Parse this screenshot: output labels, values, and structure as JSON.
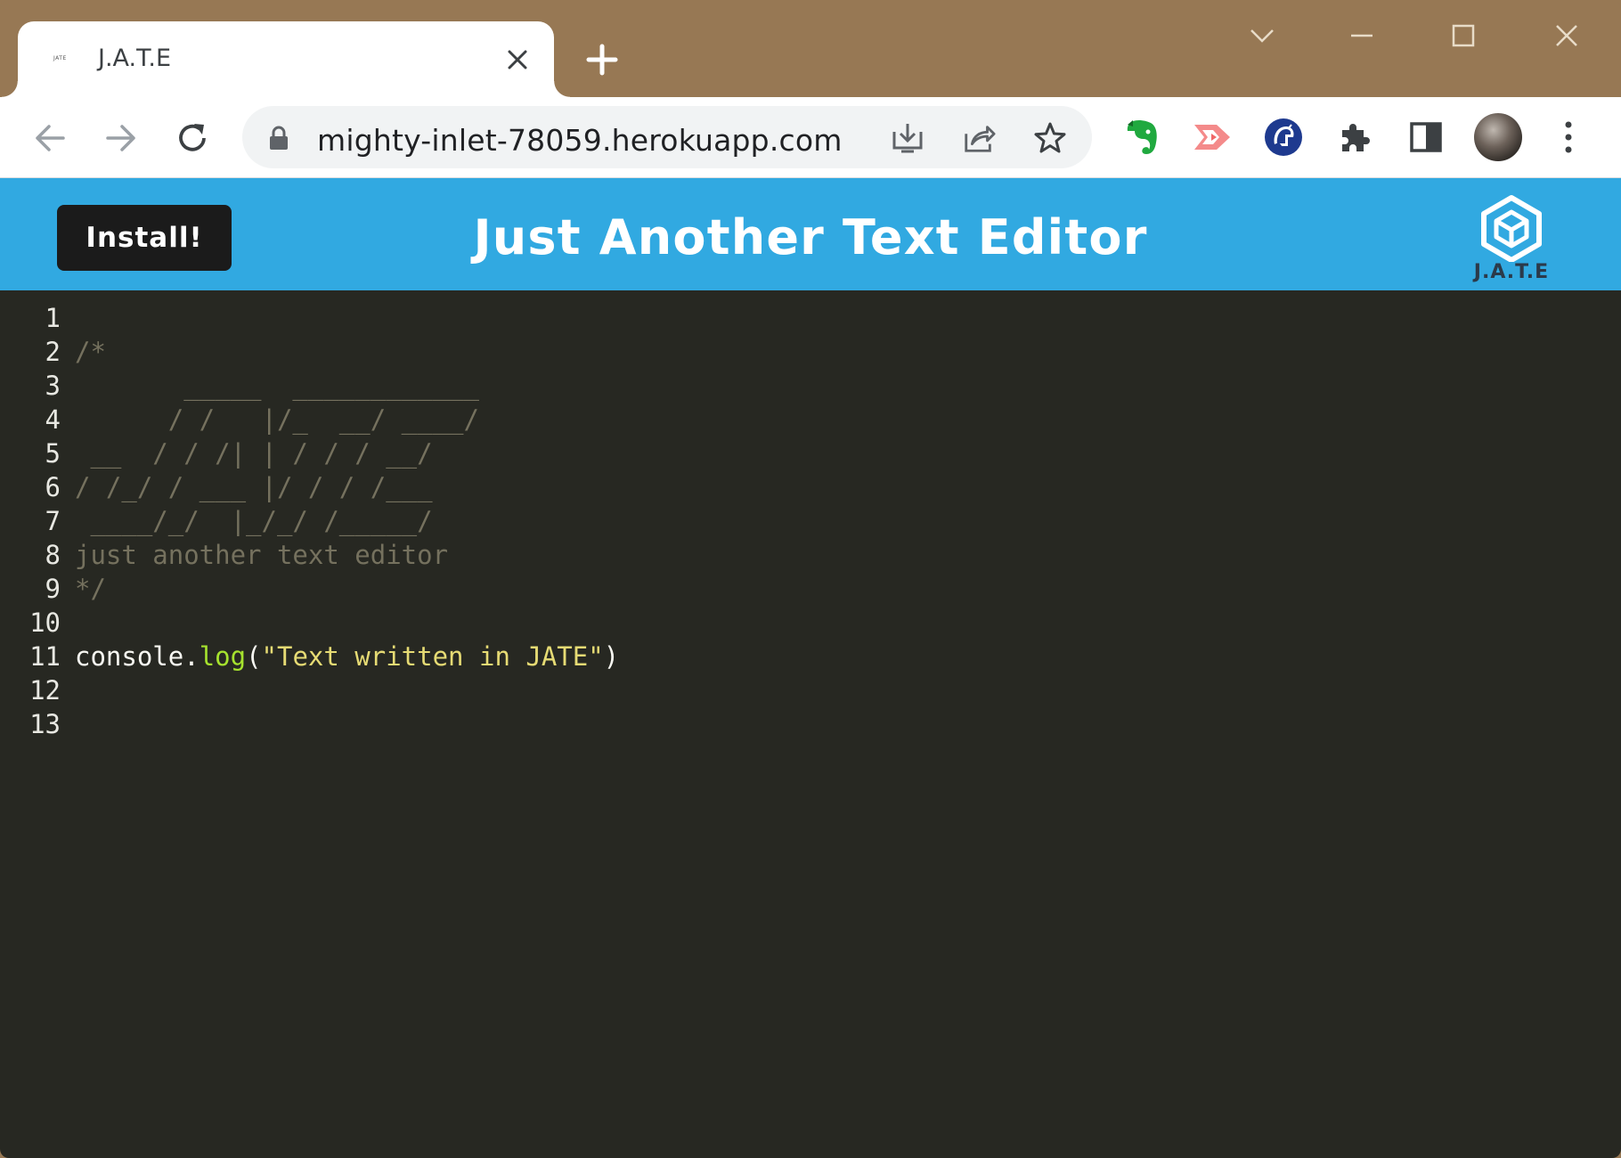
{
  "browser": {
    "tab": {
      "title": "J.A.T.E",
      "favicon_text": "JATE"
    },
    "url": "mighty-inlet-78059.herokuapp.com",
    "icons": {
      "back": "arrow-left-icon",
      "forward": "arrow-right-icon",
      "reload": "reload-icon",
      "lock": "lock-icon",
      "install": "install-app-icon",
      "share": "share-icon",
      "bookmark": "star-icon",
      "extensions": [
        "evernote-icon",
        "video-extension-icon",
        "helmet-extension-icon",
        "puzzle-icon",
        "side-panel-icon"
      ],
      "menu": "kebab-menu-icon"
    }
  },
  "app": {
    "install_label": "Install!",
    "title": "Just Another Text Editor",
    "logo_text": "J.A.T.E",
    "colors": {
      "header": "#31a9e1",
      "editor_bg": "#272822",
      "comment": "#75715e",
      "function": "#a6e22e",
      "string": "#e6db74"
    }
  },
  "editor": {
    "lines": [
      {
        "num": "1",
        "tokens": []
      },
      {
        "num": "2",
        "tokens": [
          {
            "t": "/*",
            "c": "c-comment"
          }
        ]
      },
      {
        "num": "3",
        "tokens": [
          {
            "t": "       _____  ____________",
            "c": "c-comment"
          }
        ]
      },
      {
        "num": "4",
        "tokens": [
          {
            "t": "      / /   |/_  __/ ____/",
            "c": "c-comment"
          }
        ]
      },
      {
        "num": "5",
        "tokens": [
          {
            "t": " __  / / /| | / / / __/",
            "c": "c-comment"
          }
        ]
      },
      {
        "num": "6",
        "tokens": [
          {
            "t": "/ /_/ / ___ |/ / / /___",
            "c": "c-comment"
          }
        ]
      },
      {
        "num": "7",
        "tokens": [
          {
            "t": " ____/_/  |_/_/ /_____/",
            "c": "c-comment"
          }
        ]
      },
      {
        "num": "8",
        "tokens": [
          {
            "t": "just another text editor",
            "c": "c-comment"
          }
        ]
      },
      {
        "num": "9",
        "tokens": [
          {
            "t": "*/",
            "c": "c-comment"
          }
        ]
      },
      {
        "num": "10",
        "tokens": []
      },
      {
        "num": "11",
        "tokens": [
          {
            "t": "console.",
            "c": "c-plain"
          },
          {
            "t": "log",
            "c": "c-fn"
          },
          {
            "t": "(",
            "c": "c-plain"
          },
          {
            "t": "\"Text written in JATE\"",
            "c": "c-str"
          },
          {
            "t": ")",
            "c": "c-plain"
          }
        ]
      },
      {
        "num": "12",
        "tokens": []
      },
      {
        "num": "13",
        "tokens": []
      }
    ]
  }
}
